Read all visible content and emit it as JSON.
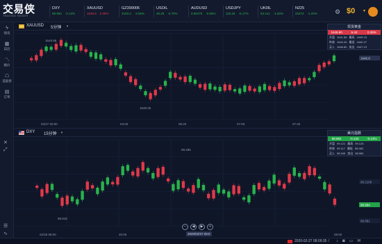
{
  "app": {
    "logo_cn": "交易侠",
    "logo_en": "TRADING KNIGHT",
    "balance": "$0",
    "colors": {
      "up": "#e0394a",
      "down": "#28b34c",
      "background": "#0f1628",
      "accent": "#f0b429"
    }
  },
  "tickers": [
    {
      "symbol": "DXY",
      "price": "98.984",
      "change": "-0.13%",
      "dir": "down"
    },
    {
      "symbol": "XAUUSD",
      "price": "1646.8",
      "change": "0.39%",
      "dir": "up"
    },
    {
      "symbol": "GZ399006",
      "price": "2193.3",
      "change": "-4.55%",
      "dir": "down"
    },
    {
      "symbol": "USOIL",
      "price": "48.28",
      "change": "-0.70%",
      "dir": "down"
    },
    {
      "symbol": "AUDUSD",
      "price": "0.65470",
      "change": "-0.06%",
      "dir": "down"
    },
    {
      "symbol": "USDJPY",
      "price": "110.25",
      "change": "-0.17%",
      "dir": "down"
    },
    {
      "symbol": "UK0IL",
      "price": "53.141",
      "change": "-1.60%",
      "dir": "down"
    },
    {
      "symbol": "N225",
      "price": "21574",
      "change": "-1.20%",
      "dir": "down"
    }
  ],
  "sidebar": {
    "items": [
      {
        "icon": "bolt-icon",
        "label": "快讯"
      },
      {
        "icon": "calendar-icon",
        "label": "日历"
      },
      {
        "icon": "chart-icon",
        "label": "报价"
      },
      {
        "icon": "robot-icon",
        "label": "选股侠"
      },
      {
        "icon": "order-icon",
        "label": "订单"
      }
    ]
  },
  "panel_top": {
    "symbol": "XAUUSD",
    "timeframe": "5分钟",
    "quote": {
      "title": "现货黄金",
      "price": "1646.80",
      "change": "6.40",
      "percent": "0.39%",
      "rows": [
        {
          "a": "开盘",
          "av": "1641.88",
          "b": "最高",
          "bv": "1649.15"
        },
        {
          "a": "昨收",
          "av": "1640.40",
          "b": "最低",
          "bv": "1640.27"
        },
        {
          "a": "买入",
          "av": "1646.80",
          "b": "卖出",
          "bv": "1647.13"
        }
      ]
    },
    "high_label": "1649.99",
    "low_label": "1635.05",
    "price_tag": "1646.8",
    "xaxis": [
      "02/27 00:00",
      "04:00",
      "05:20",
      "07:00",
      "07:40"
    ]
  },
  "panel_bottom": {
    "symbol": "DXY",
    "timeframe": "15分钟",
    "quote": {
      "title": "美元指数",
      "price": "98.984",
      "change": "-0.133",
      "percent": "-0.13%",
      "rows": [
        {
          "a": "开盘",
          "av": "99.121",
          "b": "最高",
          "bv": "99.125"
        },
        {
          "a": "昨收",
          "av": "99.117",
          "b": "最低",
          "bv": "98.962"
        },
        {
          "a": "买入",
          "av": "98.945",
          "b": "卖出",
          "bv": "98.984"
        }
      ]
    },
    "high_label": "99.285",
    "low_label": "98.818",
    "right_labels": [
      "99.2108",
      "98.984",
      "98.881"
    ],
    "xaxis": [
      "02/26 08:00",
      "20:00",
      "04:00",
      "08:00"
    ]
  },
  "footer": {
    "cursor_date": "2020/02/27 09:0",
    "time": "2020-02-27 08:09:35 ☾",
    "controls": [
      "−",
      "◀",
      "▶",
      "+"
    ]
  }
}
